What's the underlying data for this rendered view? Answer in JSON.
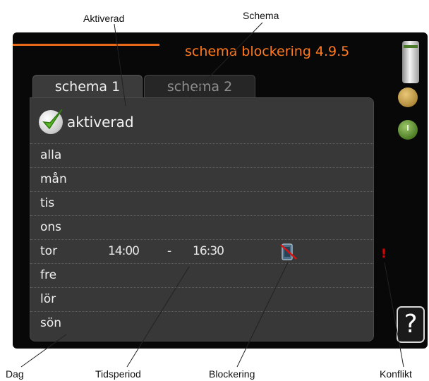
{
  "callouts": {
    "aktiverad": "Aktiverad",
    "schema": "Schema",
    "dag": "Dag",
    "tidsperiod": "Tidsperiod",
    "blockering": "Blockering",
    "konflikt": "Konflikt"
  },
  "screen": {
    "title": "schema blockering 4.9.5",
    "tabs": [
      {
        "label": "schema 1",
        "active": true
      },
      {
        "label": "schema 2",
        "active": false
      }
    ],
    "activated": {
      "label": "aktiverad",
      "checked": true
    },
    "days": [
      {
        "name": "alla",
        "start": "",
        "end": "",
        "blocked": false
      },
      {
        "name": "mån",
        "start": "",
        "end": "",
        "blocked": false
      },
      {
        "name": "tis",
        "start": "",
        "end": "",
        "blocked": false
      },
      {
        "name": "ons",
        "start": "",
        "end": "",
        "blocked": false
      },
      {
        "name": "tor",
        "start": "14:00",
        "separator": "-",
        "end": "16:30",
        "blocked": true
      },
      {
        "name": "fre",
        "start": "",
        "end": "",
        "blocked": false
      },
      {
        "name": "lör",
        "start": "",
        "end": "",
        "blocked": false
      },
      {
        "name": "sön",
        "start": "",
        "end": "",
        "blocked": false
      }
    ],
    "conflict_marker": "!",
    "help_label": "?"
  },
  "colors": {
    "title": "#ff7a1e",
    "accent_line": "#e86a17",
    "conflict": "#e00000",
    "panel": "#383838"
  },
  "icons": {
    "check": "green-check-icon",
    "block": "compressor-blocked-icon",
    "side": [
      "battery-icon",
      "face-icon",
      "clock-icon"
    ],
    "help": "help-icon"
  }
}
